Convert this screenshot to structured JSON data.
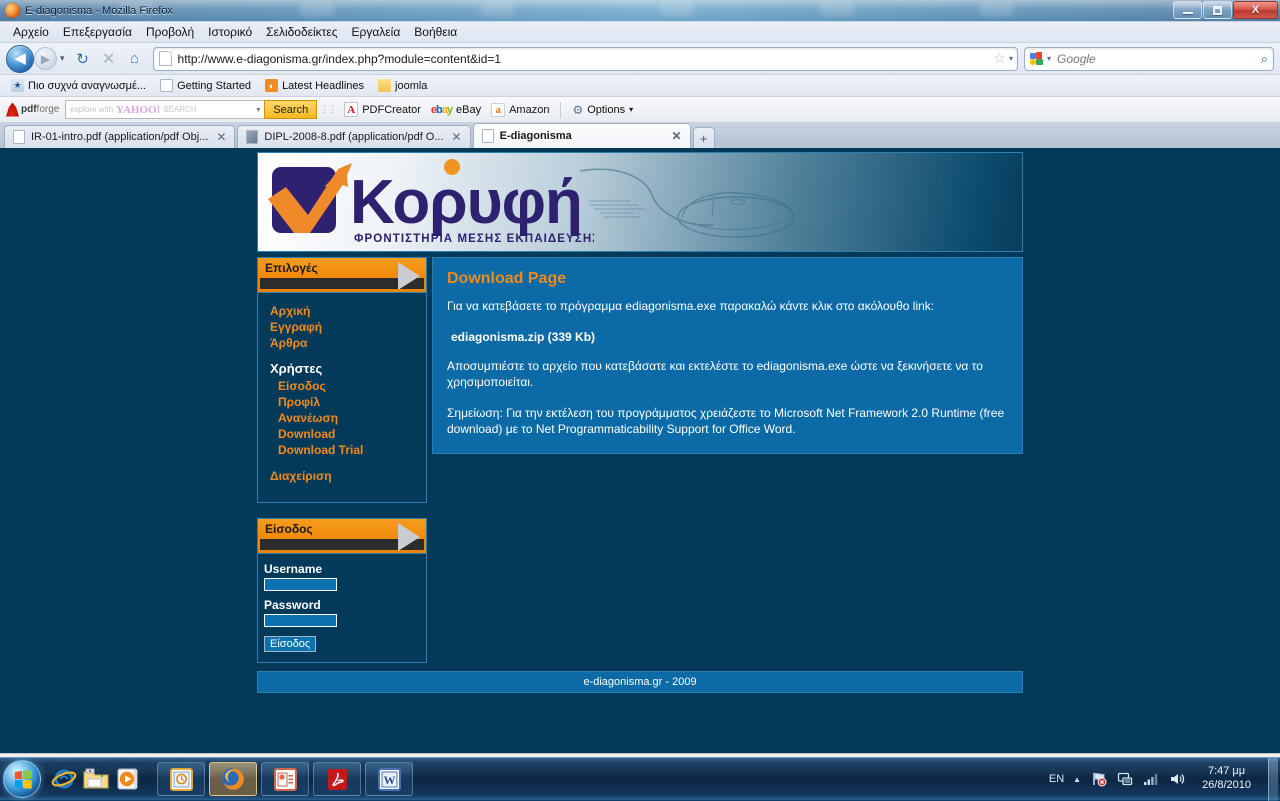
{
  "window": {
    "title": "E-diagonisma - Mozilla Firefox",
    "minimize_label": "Minimize",
    "maximize_label": "Restore",
    "close_label": "X"
  },
  "menubar": [
    {
      "label": "Αρχείο"
    },
    {
      "label": "Επεξεργασία"
    },
    {
      "label": "Προβολή"
    },
    {
      "label": "Ιστορικό"
    },
    {
      "label": "Σελιδοδείκτες"
    },
    {
      "label": "Εργαλεία"
    },
    {
      "label": "Βοήθεια"
    }
  ],
  "navbar": {
    "back_glyph": "◀",
    "forward_glyph": "▶",
    "dropdown_glyph": "▾",
    "reload_glyph": "↻",
    "stop_glyph": "✕",
    "home_glyph": "⌂",
    "url": "http://www.e-diagonisma.gr/index.php?module=content&id=1",
    "star_glyph": "☆",
    "urlbar_caret": "▾",
    "search_placeholder": "Google",
    "search_value": "",
    "search_caret": "▾",
    "magnifier_glyph": "⌕"
  },
  "bookmarks": [
    {
      "label": "Πιο συχνά αναγνωσμέ...",
      "icon": "most-visited-icon"
    },
    {
      "label": "Getting Started",
      "icon": "document-icon"
    },
    {
      "label": "Latest Headlines",
      "icon": "rss-icon"
    },
    {
      "label": "joomla",
      "icon": "folder-icon"
    }
  ],
  "pdfbar": {
    "brand_prefix": "pdf",
    "brand_suffix": "forge",
    "yahoo_placeholder_pre": "explore with",
    "yahoo_logo": "YAHOO!",
    "yahoo_placeholder_post": "SEARCH",
    "yahoo_value": "",
    "search_button": "Search",
    "items": [
      {
        "label": "PDFCreator",
        "icon": "acrobat-icon"
      },
      {
        "label": "eBay",
        "icon": "ebay-icon"
      },
      {
        "label": "Amazon",
        "icon": "amazon-icon"
      },
      {
        "label": "Options",
        "icon": "gear-icon",
        "caret": "▾"
      }
    ]
  },
  "tabs": [
    {
      "label": "IR-01-intro.pdf (application/pdf Obj...",
      "active": false,
      "close": "✕",
      "favicon": "document-icon"
    },
    {
      "label": "DIPL-2008-8.pdf (application/pdf O...",
      "active": false,
      "close": "✕",
      "favicon": "image-icon"
    },
    {
      "label": "E-diagonisma",
      "active": true,
      "close": "✕",
      "favicon": "document-icon"
    }
  ],
  "new_tab_glyph": "+",
  "page": {
    "banner": {
      "logo_text": "Κορυφή",
      "logo_subtitle": "ΦΡΟΝΤΙΣΤΗΡΙΑ ΜΕΣΗΣ ΕΚΠΑΙΔΕΥΣΗΣ",
      "decoration": "computer-mouse-illustration"
    },
    "menu_panel": {
      "header": "Επιλογές",
      "links": [
        {
          "label": "Αρχική"
        },
        {
          "label": "Εγγραφή"
        },
        {
          "label": "Άρθρα"
        }
      ],
      "group_title": "Χρήστες",
      "sub_links": [
        {
          "label": "Είσοδος"
        },
        {
          "label": "Προφίλ"
        },
        {
          "label": "Ανανέωση"
        },
        {
          "label": "Download"
        },
        {
          "label": "Download Trial"
        }
      ],
      "admin_link": {
        "label": "Διαχείριση"
      }
    },
    "login_panel": {
      "header": "Είσοδος",
      "username_label": "Username",
      "username_value": "",
      "password_label": "Password",
      "password_value": "",
      "submit_label": "Είσοδος"
    },
    "content": {
      "title": "Download Page",
      "intro": "Για να κατεβάσετε το πρόγραμμα ediagonisma.exe παρακαλώ κάντε κλικ στο ακόλουθο link:",
      "download_link": "ediagonisma.zip (339 Kb)",
      "instructions": "Αποσυμπιέστε το αρχείο που κατεβάσατε και εκτελέστε το ediagonisma.exe ώστε να ξεκινήσετε να το χρησιμοποιείται.",
      "note": "Σημείωση: Για την εκτέλεση του προγράμματος χρειάζεστε το Microsoft Net Framework 2.0 Runtime (free download) με το Net Programmaticability Support for Office Word."
    },
    "footer": "e-diagonisma.gr - 2009"
  },
  "statusbar": {
    "text": "http://e-diagonisma.gr/files/ediagonisma.zip"
  },
  "taskbar": {
    "start_label": "Start",
    "quick_launch": [
      {
        "name": "internet-explorer-icon"
      },
      {
        "name": "windows-explorer-icon"
      },
      {
        "name": "media-player-icon"
      }
    ],
    "tasks": [
      {
        "name": "outlook-icon",
        "active": false
      },
      {
        "name": "firefox-icon",
        "active": true
      },
      {
        "name": "powerpoint-icon",
        "active": false
      },
      {
        "name": "acrobat-reader-icon",
        "active": false
      },
      {
        "name": "word-icon",
        "active": false
      }
    ],
    "tray": {
      "language": "EN",
      "caret": "▲",
      "icons": [
        {
          "name": "action-center-flag-icon"
        },
        {
          "name": "network-icon"
        },
        {
          "name": "wireless-signal-icon"
        },
        {
          "name": "volume-icon"
        }
      ],
      "time": "7:47 μμ",
      "date": "26/8/2010"
    }
  },
  "colors": {
    "page_bg": "#033a5a",
    "content_bg": "#0c6ba6",
    "accent_orange": "#f08a1c",
    "border_blue": "#2e7fae",
    "logo_purple": "#2e2170"
  }
}
